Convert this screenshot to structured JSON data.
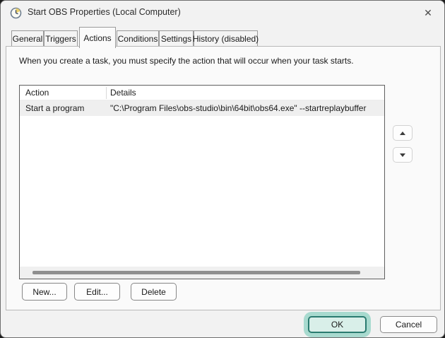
{
  "window": {
    "title": "Start OBS Properties (Local Computer)",
    "close_glyph": "✕"
  },
  "tabs": [
    {
      "label": "General"
    },
    {
      "label": "Triggers"
    },
    {
      "label": "Actions"
    },
    {
      "label": "Conditions"
    },
    {
      "label": "Settings"
    },
    {
      "label": "History (disabled)"
    }
  ],
  "active_tab": "Actions",
  "description": "When you create a task, you must specify the action that will occur when your task starts.",
  "actions_list": {
    "columns": [
      "Action",
      "Details"
    ],
    "rows": [
      {
        "action": "Start a program",
        "details": "\"C:\\Program Files\\obs-studio\\bin\\64bit\\obs64.exe\" --startreplaybuffer",
        "selected": true
      }
    ]
  },
  "buttons": {
    "new": "New...",
    "edit": "Edit...",
    "delete": "Delete",
    "ok": "OK",
    "cancel": "Cancel"
  },
  "icons": {
    "app": "task-scheduler-clock-icon",
    "move_up": "up-triangle-icon",
    "move_down": "down-triangle-icon"
  },
  "colors": {
    "ok_focus_glow": "#a8dacf",
    "ok_fill": "#d9efe9",
    "ok_border": "#2a7b70",
    "selected_row": "#efefef",
    "dialog_bg": "#f2f2f2",
    "panel_bg": "#fafafa"
  }
}
